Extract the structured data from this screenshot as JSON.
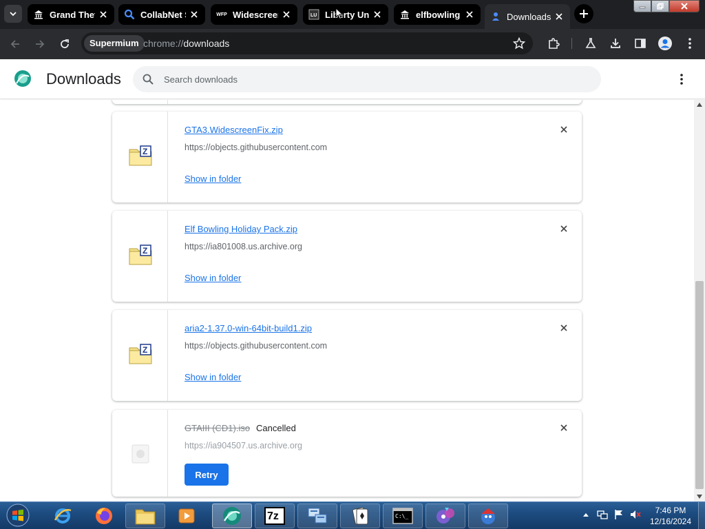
{
  "browser": {
    "tabs": [
      {
        "title": "Grand Theft",
        "favicon": "institution-icon",
        "active": false
      },
      {
        "title": "CollabNet S",
        "favicon": "search-magnifier-icon",
        "active": false
      },
      {
        "title": "Widescreen",
        "favicon": "wfp-logo-icon",
        "active": false
      },
      {
        "title": "Liberty Uni",
        "favicon": "liberty-icon",
        "active": false
      },
      {
        "title": "elfbowling",
        "favicon": "institution-icon",
        "active": false
      },
      {
        "title": "Downloads",
        "favicon": "downloads-icon",
        "active": true
      }
    ],
    "wfp_label": "WFP",
    "omnibox_chip": "Supermium",
    "url_scheme": "chrome://",
    "url_host": "downloads"
  },
  "page": {
    "title": "Downloads",
    "search_placeholder": "Search downloads"
  },
  "downloads": [
    {
      "filename": "GTA3.WidescreenFix.zip",
      "source": "https://objects.githubusercontent.com",
      "action": "Show in folder",
      "state": "complete"
    },
    {
      "filename": "Elf Bowling Holiday Pack.zip",
      "source": "https://ia801008.us.archive.org",
      "action": "Show in folder",
      "state": "complete"
    },
    {
      "filename": "aria2-1.37.0-win-64bit-build1.zip",
      "source": "https://objects.githubusercontent.com",
      "action": "Show in folder",
      "state": "complete"
    },
    {
      "filename": "GTAIII (CD1).iso",
      "status": "Cancelled",
      "source": "https://ia904507.us.archive.org",
      "action": "Retry",
      "state": "cancelled"
    }
  ],
  "taskbar": {
    "apps": [
      "internet-explorer",
      "firefox",
      "file-explorer",
      "media-player",
      "supermium-browser",
      "7zip",
      "network-tool",
      "solitaire",
      "command-prompt",
      "disk-tool",
      "game"
    ],
    "sevenzip_label": "7z",
    "cmd_label": "C:\\_",
    "time": "7:46 PM",
    "date": "12/16/2024"
  },
  "colors": {
    "accent": "#1a73e8",
    "tabstrip": "#1f2023",
    "toolbar": "#2b2c2f",
    "taskbar": "#1d4c80"
  }
}
